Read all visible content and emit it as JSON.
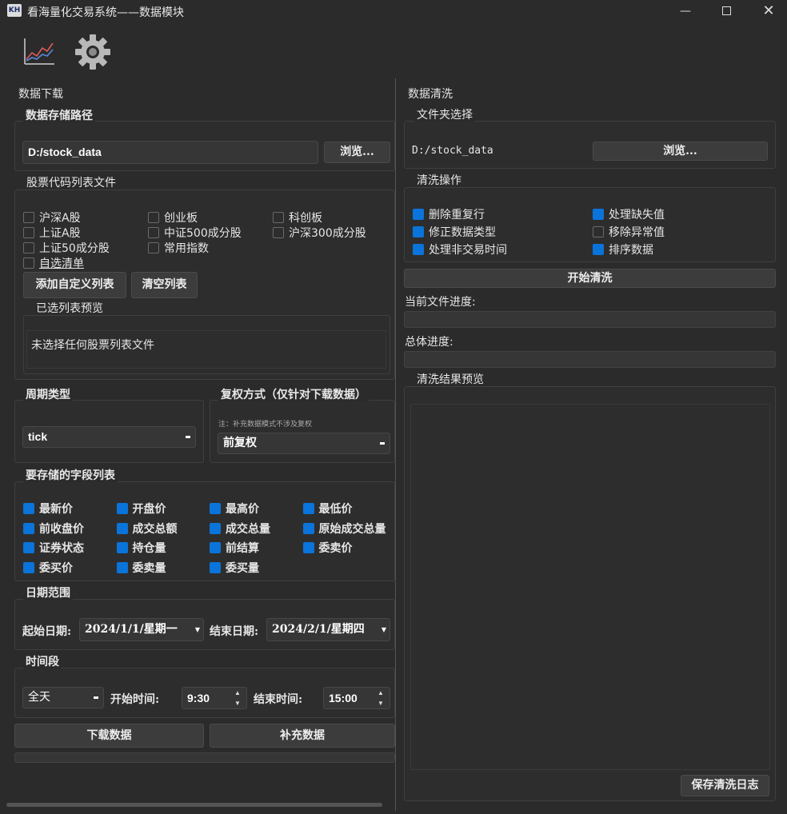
{
  "window": {
    "title": "看海量化交易系统——数据模块",
    "logo": "KH"
  },
  "left": {
    "section_title": "数据下载",
    "storage": {
      "title": "数据存储路径",
      "path": "D:/stock_data",
      "browse": "浏览..."
    },
    "stock_list": {
      "title": "股票代码列表文件",
      "options": [
        {
          "label": "沪深A股",
          "checked": false
        },
        {
          "label": "创业板",
          "checked": false
        },
        {
          "label": "科创板",
          "checked": false
        },
        {
          "label": "上证A股",
          "checked": false
        },
        {
          "label": "中证500成分股",
          "checked": false
        },
        {
          "label": "沪深300成分股",
          "checked": false
        },
        {
          "label": "上证50成分股",
          "checked": false
        },
        {
          "label": "常用指数",
          "checked": false
        },
        {
          "label": "自选清单",
          "checked": false
        }
      ],
      "add_custom": "添加自定义列表",
      "clear": "清空列表",
      "preview_title": "已选列表预览",
      "preview_text": "未选择任何股票列表文件"
    },
    "period": {
      "title": "周期类型",
      "value": "tick"
    },
    "adjust": {
      "title": "复权方式（仅针对下载数据）",
      "note": "注：补充数据模式不涉及复权",
      "value": "前复权"
    },
    "fields": {
      "title": "要存储的字段列表",
      "items": [
        {
          "label": "最新价",
          "checked": true
        },
        {
          "label": "开盘价",
          "checked": true
        },
        {
          "label": "最高价",
          "checked": true
        },
        {
          "label": "最低价",
          "checked": true
        },
        {
          "label": "前收盘价",
          "checked": true
        },
        {
          "label": "成交总额",
          "checked": true
        },
        {
          "label": "成交总量",
          "checked": true
        },
        {
          "label": "原始成交总量",
          "checked": true
        },
        {
          "label": "证券状态",
          "checked": true
        },
        {
          "label": "持仓量",
          "checked": true
        },
        {
          "label": "前结算",
          "checked": true
        },
        {
          "label": "委卖价",
          "checked": true
        },
        {
          "label": "委买价",
          "checked": true
        },
        {
          "label": "委卖量",
          "checked": true
        },
        {
          "label": "委买量",
          "checked": true
        }
      ]
    },
    "date_range": {
      "title": "日期范围",
      "start_label": "起始日期:",
      "start_value": "2024/1/1/星期一",
      "end_label": "结束日期:",
      "end_value": "2024/2/1/星期四"
    },
    "time_range": {
      "title": "时间段",
      "mode": "全天",
      "start_label": "开始时间:",
      "start_value": "9:30",
      "end_label": "结束时间:",
      "end_value": "15:00"
    },
    "download": "下载数据",
    "supplement": "补充数据"
  },
  "right": {
    "section_title": "数据清洗",
    "folder": {
      "title": "文件夹选择",
      "path": "D:/stock_data",
      "browse": "浏览..."
    },
    "ops": {
      "title": "清洗操作",
      "items": [
        {
          "label": "删除重复行",
          "checked": true
        },
        {
          "label": "处理缺失值",
          "checked": true
        },
        {
          "label": "修正数据类型",
          "checked": true
        },
        {
          "label": "移除异常值",
          "checked": false
        },
        {
          "label": "处理非交易时间",
          "checked": true
        },
        {
          "label": "排序数据",
          "checked": true
        }
      ]
    },
    "start": "开始清洗",
    "file_progress": "当前文件进度:",
    "total_progress": "总体进度:",
    "result_title": "清洗结果预览",
    "save_log": "保存清洗日志"
  },
  "icons": {
    "chart": "line-chart-icon",
    "settings": "gear-icon"
  }
}
